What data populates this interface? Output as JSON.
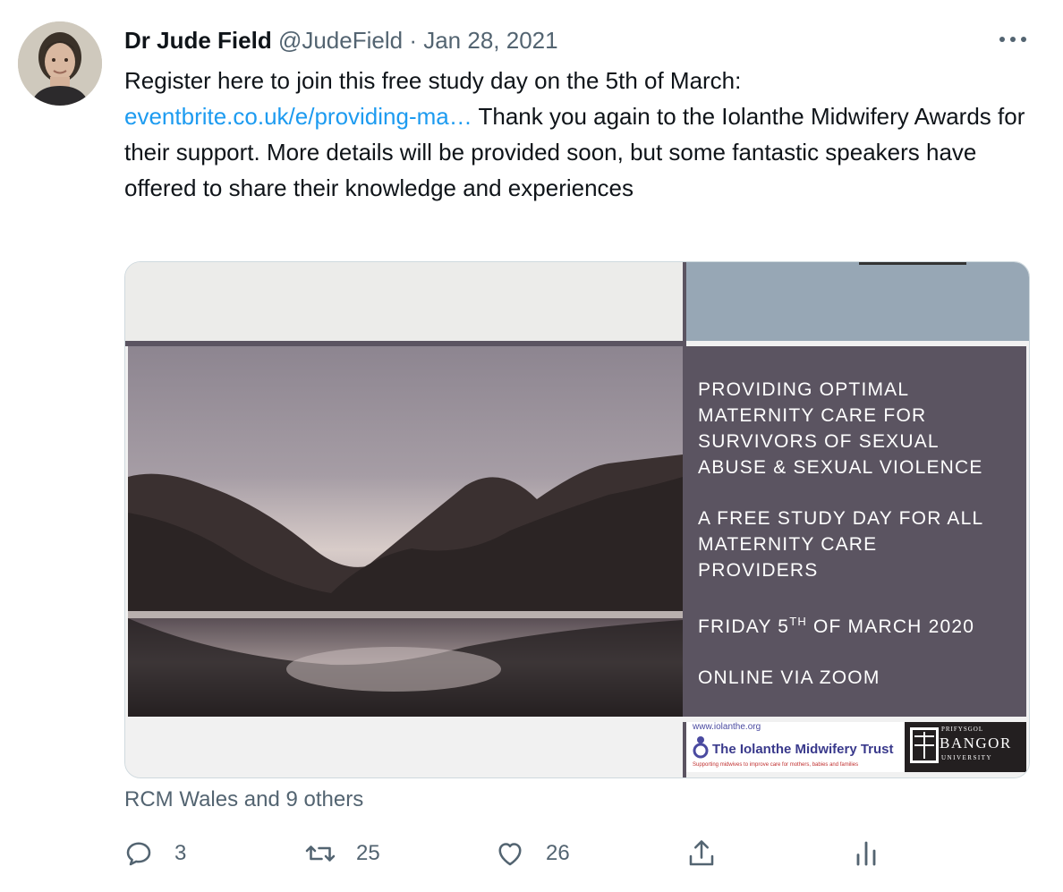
{
  "tweet": {
    "author_name": "Dr Jude Field",
    "author_handle": "@JudeField",
    "separator": "·",
    "date": "Jan 28, 2021",
    "text_before_link": "Register here to join this free study day on the 5th of March:",
    "link_text": "eventbrite.co.uk/e/providing-ma…",
    "text_after_link": " Thank you again to the Iolanthe Midwifery Awards for their support. More details will be provided soon, but some fantastic speakers have offered to share their knowledge and experiences",
    "liked_by": "RCM Wales and 9 others"
  },
  "poster": {
    "title_lines": [
      "PROVIDING OPTIMAL",
      "MATERNITY CARE FOR",
      "SURVIVORS OF SEXUAL",
      "ABUSE & SEXUAL VIOLENCE"
    ],
    "subtitle_lines": [
      "A FREE STUDY DAY FOR ALL",
      "MATERNITY CARE",
      "PROVIDERS"
    ],
    "date_prefix": "FRIDAY 5",
    "date_sup": "TH",
    "date_suffix": " OF MARCH 2020",
    "venue": "ONLINE VIA ZOOM",
    "iolanthe_url": "www.iolanthe.org",
    "iolanthe_name": "The Iolanthe Midwifery Trust",
    "iolanthe_tagline": "Supporting midwives to improve care for mothers, babies and families",
    "bangor_top": "PRIFYSGOL",
    "bangor_name": "BANGOR",
    "bangor_bottom": "UNIVERSITY"
  },
  "actions": {
    "reply_count": "3",
    "retweet_count": "25",
    "like_count": "26"
  },
  "icons": {
    "more": "more-horizontal-icon",
    "reply": "reply-icon",
    "retweet": "retweet-icon",
    "like": "heart-icon",
    "share": "share-icon",
    "analytics": "analytics-icon"
  },
  "colors": {
    "link": "#1d9bf0",
    "secondary_text": "#536471",
    "poster_panel": "#5b5461",
    "poster_top_panel": "#97a7b5"
  }
}
